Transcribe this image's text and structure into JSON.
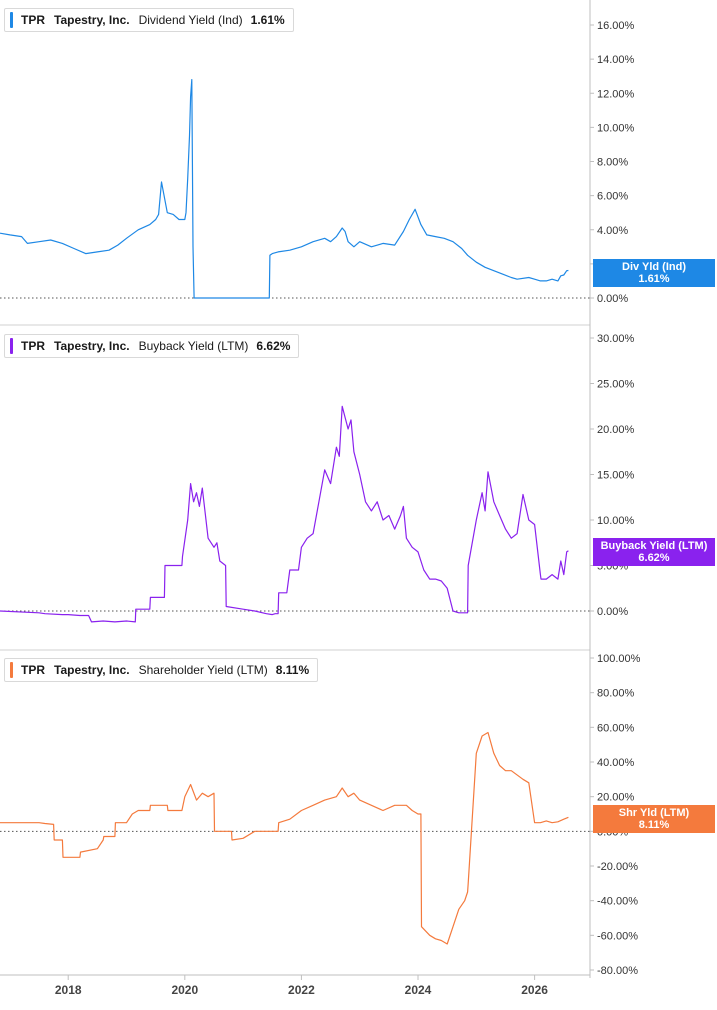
{
  "chart_data": [
    {
      "type": "line",
      "ticker": "TPR",
      "company": "Tapestry, Inc.",
      "metric": "Dividend Yield (Ind)",
      "current_value": "1.61%",
      "badge_text": [
        "Div Yld (Ind)",
        "1.61%"
      ],
      "color": "#1e88e5",
      "ylim": [
        0,
        16
      ],
      "yticks": [
        0,
        2,
        4,
        6,
        8,
        10,
        12,
        14,
        16
      ],
      "ytick_labels": [
        "0.00%",
        "2.00%",
        "4.00%",
        "6.00%",
        "8.00%",
        "10.00%",
        "12.00%",
        "14.00%",
        "16.00%"
      ],
      "zero_line": true,
      "series": [
        {
          "x": [
            2016.83,
            2017.0,
            2017.2,
            2017.3,
            2017.5,
            2017.7,
            2017.9,
            2018.1,
            2018.3,
            2018.5,
            2018.7,
            2018.85,
            2019.0,
            2019.2,
            2019.4,
            2019.5,
            2019.55,
            2019.6,
            2019.7,
            2019.8,
            2019.9,
            2020.0,
            2020.02,
            2020.05,
            2020.08,
            2020.1,
            2020.12,
            2020.13,
            2020.14,
            2020.16,
            2020.18,
            2020.2,
            2020.21,
            2020.22,
            2020.5,
            2021.0,
            2021.3,
            2021.45,
            2021.46,
            2021.5,
            2021.6,
            2021.8,
            2022.0,
            2022.2,
            2022.4,
            2022.5,
            2022.6,
            2022.7,
            2022.75,
            2022.8,
            2022.9,
            2023.0,
            2023.2,
            2023.4,
            2023.6,
            2023.75,
            2023.85,
            2023.95,
            2024.05,
            2024.15,
            2024.3,
            2024.45,
            2024.6,
            2024.75,
            2024.85,
            2025.0,
            2025.15,
            2025.3,
            2025.45,
            2025.6,
            2025.7,
            2025.9,
            2026.0,
            2026.1,
            2026.2,
            2026.3,
            2026.4,
            2026.45,
            2026.5,
            2026.55,
            2026.58
          ],
          "y": [
            3.8,
            3.7,
            3.6,
            3.2,
            3.3,
            3.4,
            3.2,
            2.9,
            2.6,
            2.7,
            2.8,
            3.1,
            3.5,
            4.0,
            4.3,
            4.6,
            4.9,
            6.8,
            5.0,
            4.9,
            4.6,
            4.6,
            5.0,
            7.0,
            9.5,
            11.8,
            12.8,
            8.0,
            3.0,
            0.0,
            0.0,
            0.0,
            0.0,
            0.0,
            0.0,
            0.0,
            0.0,
            0.0,
            2.5,
            2.6,
            2.7,
            2.8,
            3.0,
            3.3,
            3.5,
            3.3,
            3.6,
            4.1,
            3.9,
            3.3,
            3.0,
            3.3,
            3.0,
            3.2,
            3.1,
            3.9,
            4.6,
            5.2,
            4.3,
            3.7,
            3.6,
            3.5,
            3.3,
            2.9,
            2.5,
            2.1,
            1.8,
            1.6,
            1.4,
            1.2,
            1.1,
            1.2,
            1.1,
            1.0,
            1.0,
            1.1,
            1.0,
            1.3,
            1.35,
            1.6,
            1.61
          ]
        }
      ]
    },
    {
      "type": "line",
      "ticker": "TPR",
      "company": "Tapestry, Inc.",
      "metric": "Buyback Yield (LTM)",
      "current_value": "6.62%",
      "badge_text": [
        "Buyback Yield (LTM)",
        "6.62%"
      ],
      "color": "#8a22ee",
      "ylim": [
        -2,
        31
      ],
      "yticks": [
        0,
        5,
        10,
        15,
        20,
        25,
        30
      ],
      "ytick_labels": [
        "0.00%",
        "5.00%",
        "10.00%",
        "15.00%",
        "20.00%",
        "25.00%",
        "30.00%"
      ],
      "zero_line": true,
      "series": [
        {
          "x": [
            2016.83,
            2017.5,
            2017.6,
            2017.9,
            2018.0,
            2018.2,
            2018.35,
            2018.4,
            2018.6,
            2018.8,
            2019.0,
            2019.15,
            2019.16,
            2019.4,
            2019.41,
            2019.65,
            2019.66,
            2019.8,
            2019.95,
            2019.96,
            2020.05,
            2020.1,
            2020.15,
            2020.2,
            2020.25,
            2020.3,
            2020.4,
            2020.5,
            2020.55,
            2020.6,
            2020.7,
            2020.71,
            2021.0,
            2021.2,
            2021.4,
            2021.5,
            2021.55,
            2021.6,
            2021.61,
            2021.75,
            2021.8,
            2021.95,
            2022.0,
            2022.1,
            2022.2,
            2022.3,
            2022.4,
            2022.5,
            2022.6,
            2022.65,
            2022.7,
            2022.8,
            2022.85,
            2022.9,
            2023.0,
            2023.1,
            2023.2,
            2023.3,
            2023.4,
            2023.5,
            2023.6,
            2023.7,
            2023.75,
            2023.8,
            2023.9,
            2024.0,
            2024.1,
            2024.2,
            2024.3,
            2024.4,
            2024.5,
            2024.6,
            2024.7,
            2024.85,
            2024.86,
            2025.0,
            2025.1,
            2025.15,
            2025.2,
            2025.3,
            2025.4,
            2025.5,
            2025.6,
            2025.7,
            2025.8,
            2025.9,
            2026.0,
            2026.1,
            2026.11,
            2026.2,
            2026.3,
            2026.4,
            2026.45,
            2026.5,
            2026.55,
            2026.58
          ],
          "y": [
            0.0,
            -0.2,
            -0.3,
            -0.4,
            -0.4,
            -0.5,
            -0.5,
            -1.2,
            -1.1,
            -1.2,
            -1.1,
            -1.2,
            0.2,
            0.2,
            1.5,
            1.5,
            5.0,
            5.0,
            5.0,
            6.0,
            10.0,
            14.0,
            12.0,
            13.0,
            11.5,
            13.5,
            8.0,
            7.0,
            7.5,
            5.5,
            5.0,
            0.5,
            0.2,
            0.0,
            -0.3,
            -0.4,
            -0.3,
            -0.3,
            2.0,
            2.0,
            4.5,
            4.5,
            7.0,
            8.0,
            8.5,
            12.0,
            15.5,
            14.0,
            18.0,
            17.0,
            22.5,
            20.0,
            21.0,
            17.5,
            15.0,
            12.0,
            11.0,
            12.0,
            10.0,
            10.5,
            9.0,
            10.5,
            11.5,
            8.0,
            7.0,
            6.5,
            4.5,
            3.5,
            3.5,
            3.3,
            2.5,
            0.0,
            -0.2,
            -0.2,
            5.0,
            10.0,
            13.0,
            11.0,
            15.3,
            12.0,
            10.5,
            9.0,
            8.0,
            8.5,
            12.8,
            10.0,
            9.5,
            4.0,
            3.5,
            3.5,
            4.0,
            3.5,
            5.5,
            4.0,
            6.5,
            6.62
          ]
        }
      ]
    },
    {
      "type": "line",
      "ticker": "TPR",
      "company": "Tapestry, Inc.",
      "metric": "Shareholder Yield (LTM)",
      "current_value": "8.11%",
      "badge_text": [
        "Shr Yld (LTM)",
        "8.11%"
      ],
      "color": "#f47a3d",
      "ylim": [
        -80,
        100
      ],
      "yticks": [
        -80,
        -60,
        -40,
        -20,
        0,
        20,
        40,
        60,
        80,
        100
      ],
      "ytick_labels": [
        "-80.00%",
        "-60.00%",
        "-40.00%",
        "-20.00%",
        "0.00%",
        "20.00%",
        "40.00%",
        "60.00%",
        "80.00%",
        "100.00%"
      ],
      "zero_line": true,
      "series": [
        {
          "x": [
            2016.83,
            2017.0,
            2017.2,
            2017.5,
            2017.6,
            2017.75,
            2017.76,
            2017.9,
            2017.91,
            2018.2,
            2018.21,
            2018.5,
            2018.6,
            2018.61,
            2018.8,
            2018.81,
            2019.0,
            2019.1,
            2019.2,
            2019.4,
            2019.41,
            2019.7,
            2019.71,
            2019.95,
            2020.0,
            2020.1,
            2020.2,
            2020.3,
            2020.4,
            2020.5,
            2020.51,
            2020.8,
            2020.81,
            2021.0,
            2021.2,
            2021.6,
            2021.61,
            2021.8,
            2022.0,
            2022.2,
            2022.4,
            2022.6,
            2022.7,
            2022.8,
            2022.9,
            2023.0,
            2023.2,
            2023.4,
            2023.6,
            2023.8,
            2023.9,
            2024.0,
            2024.05,
            2024.06,
            2024.2,
            2024.3,
            2024.4,
            2024.5,
            2024.6,
            2024.7,
            2024.8,
            2024.85,
            2024.86,
            2025.0,
            2025.1,
            2025.2,
            2025.3,
            2025.4,
            2025.5,
            2025.6,
            2025.8,
            2025.9,
            2026.0,
            2026.1,
            2026.2,
            2026.3,
            2026.4,
            2026.5,
            2026.58
          ],
          "y": [
            5.0,
            5.0,
            5.0,
            5.0,
            4.5,
            4.0,
            -5.0,
            -5.0,
            -15.0,
            -15.0,
            -12.0,
            -10.0,
            -5.0,
            -3.0,
            -3.0,
            5.0,
            5.0,
            10.0,
            12.0,
            12.0,
            15.0,
            15.0,
            12.0,
            12.0,
            20.0,
            27.0,
            18.0,
            22.0,
            20.0,
            22.0,
            0.0,
            0.0,
            -5.0,
            -4.0,
            0.0,
            0.0,
            5.0,
            7.0,
            12.0,
            15.0,
            18.0,
            20.0,
            25.0,
            20.0,
            22.0,
            18.0,
            15.0,
            12.0,
            15.0,
            15.0,
            12.0,
            10.0,
            10.0,
            -55.0,
            -60.0,
            -62.0,
            -63.0,
            -65.0,
            -55.0,
            -45.0,
            -40.0,
            -35.0,
            -30.0,
            45.0,
            55.0,
            57.0,
            45.0,
            38.0,
            35.0,
            35.0,
            30.0,
            28.0,
            5.0,
            5.0,
            6.0,
            5.0,
            5.5,
            7.0,
            8.11
          ]
        }
      ]
    }
  ],
  "x_axis": {
    "xlim": [
      2016.83,
      2026.95
    ],
    "ticks": [
      2018,
      2020,
      2022,
      2024,
      2026
    ],
    "tick_labels": [
      "2018",
      "2020",
      "2022",
      "2024",
      "2026"
    ]
  }
}
